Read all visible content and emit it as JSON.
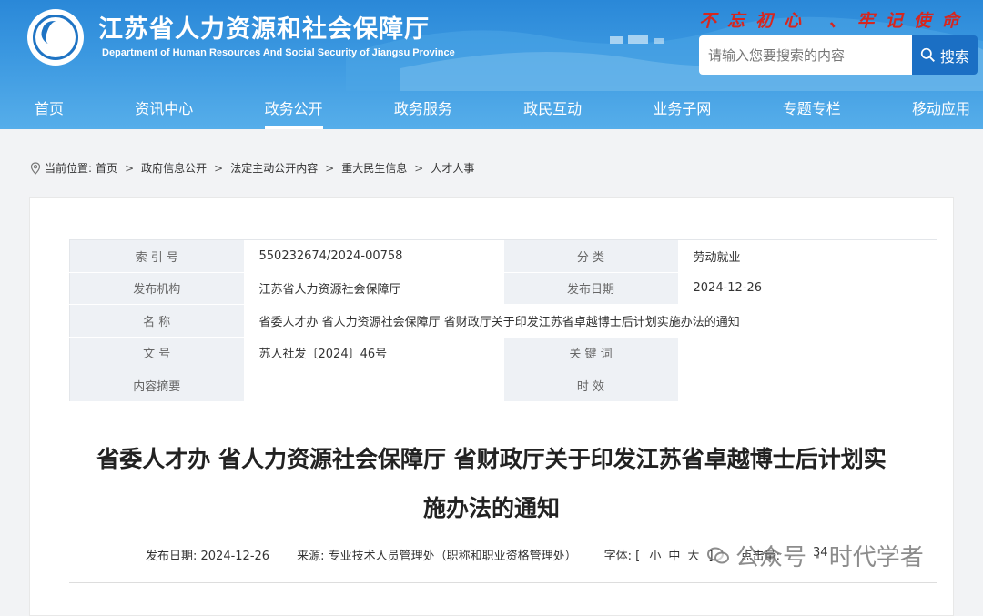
{
  "header": {
    "title": "江苏省人力资源和社会保障厅",
    "subtitle": "Department of Human Resources And Social Security of Jiangsu Province",
    "slogan": "不忘初心 、牢记使命",
    "search_placeholder": "请输入您要搜索的内容",
    "search_button": "搜索"
  },
  "nav": {
    "items": [
      {
        "label": "首页"
      },
      {
        "label": "资讯中心"
      },
      {
        "label": "政务公开"
      },
      {
        "label": "政务服务"
      },
      {
        "label": "政民互动"
      },
      {
        "label": "业务子网"
      },
      {
        "label": "专题专栏"
      },
      {
        "label": "移动应用"
      }
    ],
    "active": "政务公开"
  },
  "breadcrumb": {
    "prefix": "当前位置:",
    "items": [
      "首页",
      "政府信息公开",
      "法定主动公开内容",
      "重大民生信息",
      "人才人事"
    ]
  },
  "meta": {
    "index_label": "索 引 号",
    "index_value": "550232674/2024-00758",
    "category_label": "分 类",
    "category_value": "劳动就业",
    "publisher_label": "发布机构",
    "publisher_value": "江苏省人力资源社会保障厅",
    "date_label": "发布日期",
    "date_value": "2024-12-26",
    "name_label": "名 称",
    "name_value": "省委人才办 省人力资源社会保障厅 省财政厅关于印发江苏省卓越博士后计划实施办法的通知",
    "docno_label": "文 号",
    "docno_value": "苏人社发〔2024〕46号",
    "keywords_label": "关 键 词",
    "keywords_value": "",
    "abstract_label": "内容摘要",
    "abstract_value": "",
    "validity_label": "时 效",
    "validity_value": ""
  },
  "document": {
    "title_line1": "省委人才办 省人力资源社会保障厅 省财政厅关于印发江苏省卓越博士后计划实",
    "title_line2": "施办法的通知",
    "publish_date": "发布日期:  2024-12-26",
    "source": "来源:  专业技术人员管理处（职称和职业资格管理处）",
    "font_label": "字体: [",
    "font_small": "小",
    "font_medium": "中",
    "font_large": "大",
    "font_close": "]",
    "clicks_label": "点击量:",
    "clicks_value": "34"
  },
  "watermark": {
    "text": "公众号 · 时代学者"
  }
}
